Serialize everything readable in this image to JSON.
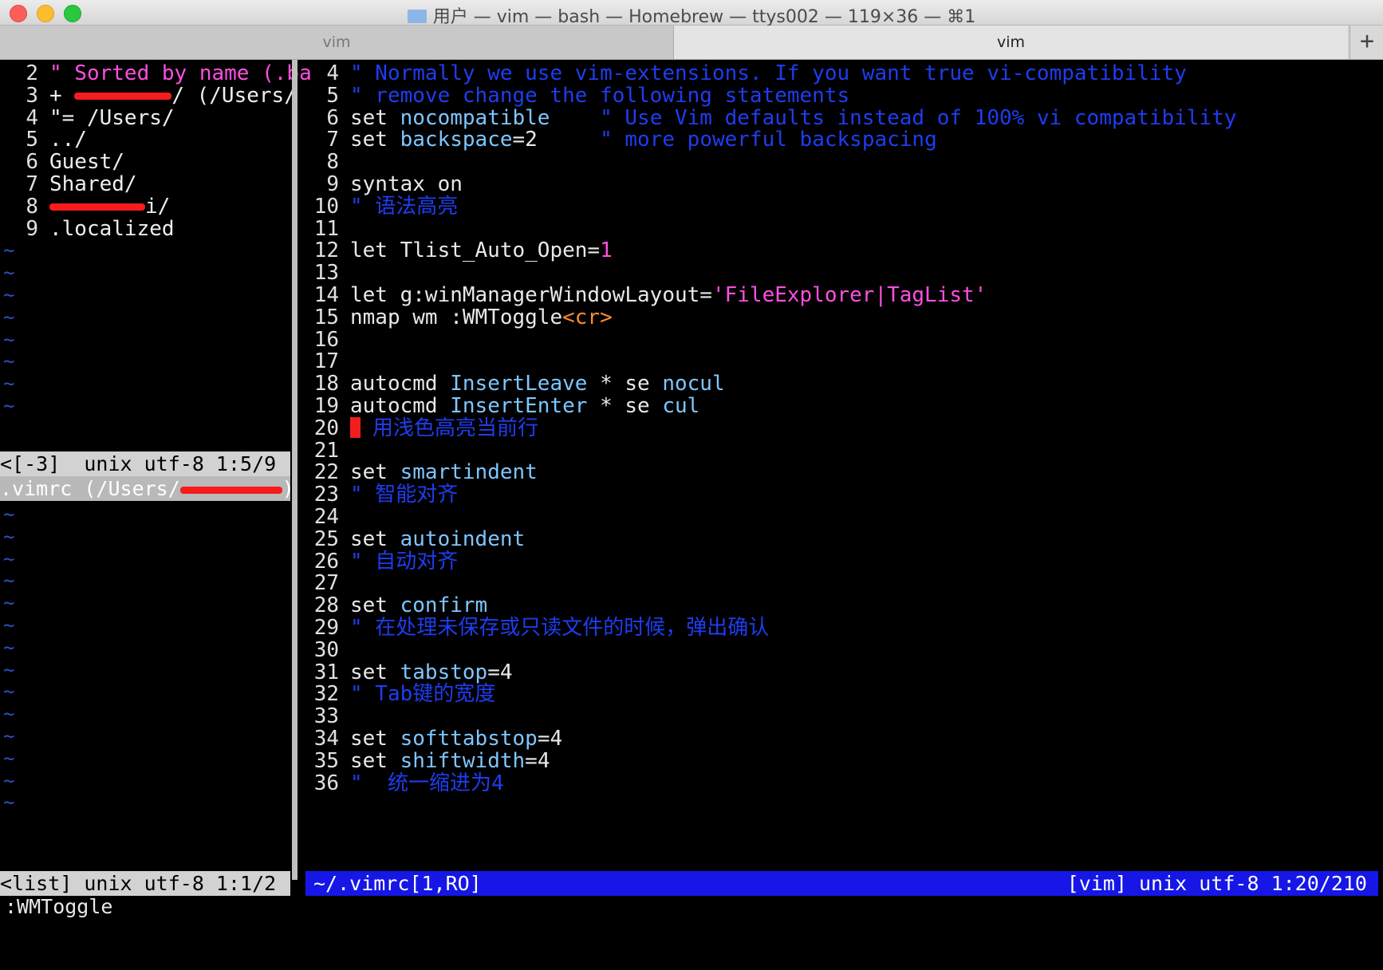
{
  "window": {
    "title": "用户 — vim — bash — Homebrew — ttys002 — 119×36 — ⌘1",
    "tabs": [
      {
        "label": "vim",
        "active": false
      },
      {
        "label": "vim",
        "active": true
      }
    ],
    "new_tab_label": "+"
  },
  "left_pane": {
    "lines": [
      {
        "n": "2",
        "text": "\" Sorted by name (.ba"
      },
      {
        "n": "3",
        "text": "+ ",
        "tail": "/ (/Users/"
      },
      {
        "n": "4",
        "text": "\"= /Users/"
      },
      {
        "n": "5",
        "text": "../"
      },
      {
        "n": "6",
        "text": "Guest/"
      },
      {
        "n": "7",
        "text": "Shared/"
      },
      {
        "n": "8",
        "text": "",
        "tail": "i/"
      },
      {
        "n": "9",
        "text": ".localized"
      }
    ],
    "status_top": "<[-3]  unix utf-8 1:5/9",
    "status_mid": ".vimrc (/Users/",
    "status_mid_tail": ")",
    "status_bottom": "<list] unix utf-8 1:1/2",
    "tilde": "~"
  },
  "right_pane": {
    "lines": [
      {
        "n": "4",
        "parts": [
          {
            "c": "cm",
            "t": "\" Normally we use vim-extensions. If you want true vi-compatibility"
          }
        ]
      },
      {
        "n": "5",
        "parts": [
          {
            "c": "cm",
            "t": "\" remove change the following statements"
          }
        ]
      },
      {
        "n": "6",
        "parts": [
          {
            "c": "kw",
            "t": "set "
          },
          {
            "c": "id",
            "t": "nocompatible"
          },
          {
            "c": "cm",
            "t": "    \" Use Vim defaults instead of 100% vi compatibility"
          }
        ]
      },
      {
        "n": "7",
        "parts": [
          {
            "c": "kw",
            "t": "set "
          },
          {
            "c": "id",
            "t": "backspace"
          },
          {
            "c": "kw",
            "t": "=2"
          },
          {
            "c": "cm",
            "t": "     \" more powerful backspacing"
          }
        ]
      },
      {
        "n": "8",
        "parts": []
      },
      {
        "n": "9",
        "parts": [
          {
            "c": "kw",
            "t": "syntax on"
          }
        ]
      },
      {
        "n": "10",
        "parts": [
          {
            "c": "cm",
            "t": "\" 语法高亮"
          }
        ]
      },
      {
        "n": "11",
        "parts": []
      },
      {
        "n": "12",
        "parts": [
          {
            "c": "kw",
            "t": "let Tlist_Auto_Open="
          },
          {
            "c": "num",
            "t": "1"
          }
        ]
      },
      {
        "n": "13",
        "parts": []
      },
      {
        "n": "14",
        "parts": [
          {
            "c": "kw",
            "t": "let g:winManagerWindowLayout="
          },
          {
            "c": "str",
            "t": "'FileExplorer|TagList'"
          }
        ]
      },
      {
        "n": "15",
        "parts": [
          {
            "c": "kw",
            "t": "nmap wm :WMToggle"
          },
          {
            "c": "sp",
            "t": "<cr>"
          }
        ]
      },
      {
        "n": "16",
        "parts": []
      },
      {
        "n": "17",
        "parts": []
      },
      {
        "n": "18",
        "parts": [
          {
            "c": "kw",
            "t": "autocmd "
          },
          {
            "c": "id",
            "t": "InsertLeave"
          },
          {
            "c": "kw",
            "t": " * se "
          },
          {
            "c": "id",
            "t": "nocul"
          }
        ]
      },
      {
        "n": "19",
        "parts": [
          {
            "c": "kw",
            "t": "autocmd "
          },
          {
            "c": "id",
            "t": "InsertEnter"
          },
          {
            "c": "kw",
            "t": " * se "
          },
          {
            "c": "id",
            "t": "cul"
          }
        ]
      },
      {
        "n": "20",
        "cursor": true,
        "parts": [
          {
            "c": "cm",
            "t": "用浅色高亮当前行"
          }
        ]
      },
      {
        "n": "21",
        "parts": []
      },
      {
        "n": "22",
        "parts": [
          {
            "c": "kw",
            "t": "set "
          },
          {
            "c": "id",
            "t": "smartindent"
          }
        ]
      },
      {
        "n": "23",
        "parts": [
          {
            "c": "cm",
            "t": "\" 智能对齐"
          }
        ]
      },
      {
        "n": "24",
        "parts": []
      },
      {
        "n": "25",
        "parts": [
          {
            "c": "kw",
            "t": "set "
          },
          {
            "c": "id",
            "t": "autoindent"
          }
        ]
      },
      {
        "n": "26",
        "parts": [
          {
            "c": "cm",
            "t": "\" 自动对齐"
          }
        ]
      },
      {
        "n": "27",
        "parts": []
      },
      {
        "n": "28",
        "parts": [
          {
            "c": "kw",
            "t": "set "
          },
          {
            "c": "id",
            "t": "confirm"
          }
        ]
      },
      {
        "n": "29",
        "parts": [
          {
            "c": "cm",
            "t": "\" 在处理未保存或只读文件的时候，弹出确认"
          }
        ]
      },
      {
        "n": "30",
        "parts": []
      },
      {
        "n": "31",
        "parts": [
          {
            "c": "kw",
            "t": "set "
          },
          {
            "c": "id",
            "t": "tabstop"
          },
          {
            "c": "kw",
            "t": "=4"
          }
        ]
      },
      {
        "n": "32",
        "parts": [
          {
            "c": "cm",
            "t": "\" Tab键的宽度"
          }
        ]
      },
      {
        "n": "33",
        "parts": []
      },
      {
        "n": "34",
        "parts": [
          {
            "c": "kw",
            "t": "set "
          },
          {
            "c": "id",
            "t": "softtabstop"
          },
          {
            "c": "kw",
            "t": "=4"
          }
        ]
      },
      {
        "n": "35",
        "parts": [
          {
            "c": "kw",
            "t": "set "
          },
          {
            "c": "id",
            "t": "shiftwidth"
          },
          {
            "c": "kw",
            "t": "=4"
          }
        ]
      },
      {
        "n": "36",
        "parts": [
          {
            "c": "cm",
            "t": "\"  统一缩进为4"
          }
        ]
      }
    ],
    "status_left": "~/.vimrc[1,RO]",
    "status_right": "[vim] unix utf-8 1:20/210"
  },
  "cmdline": ":WMToggle",
  "colors": {
    "status_blue": "#1616e6",
    "comment": "#1e3df0",
    "option": "#7ec6ff",
    "number": "#ff4fe0",
    "special": "#ff8a2a",
    "cursor": "#f01e1e"
  }
}
